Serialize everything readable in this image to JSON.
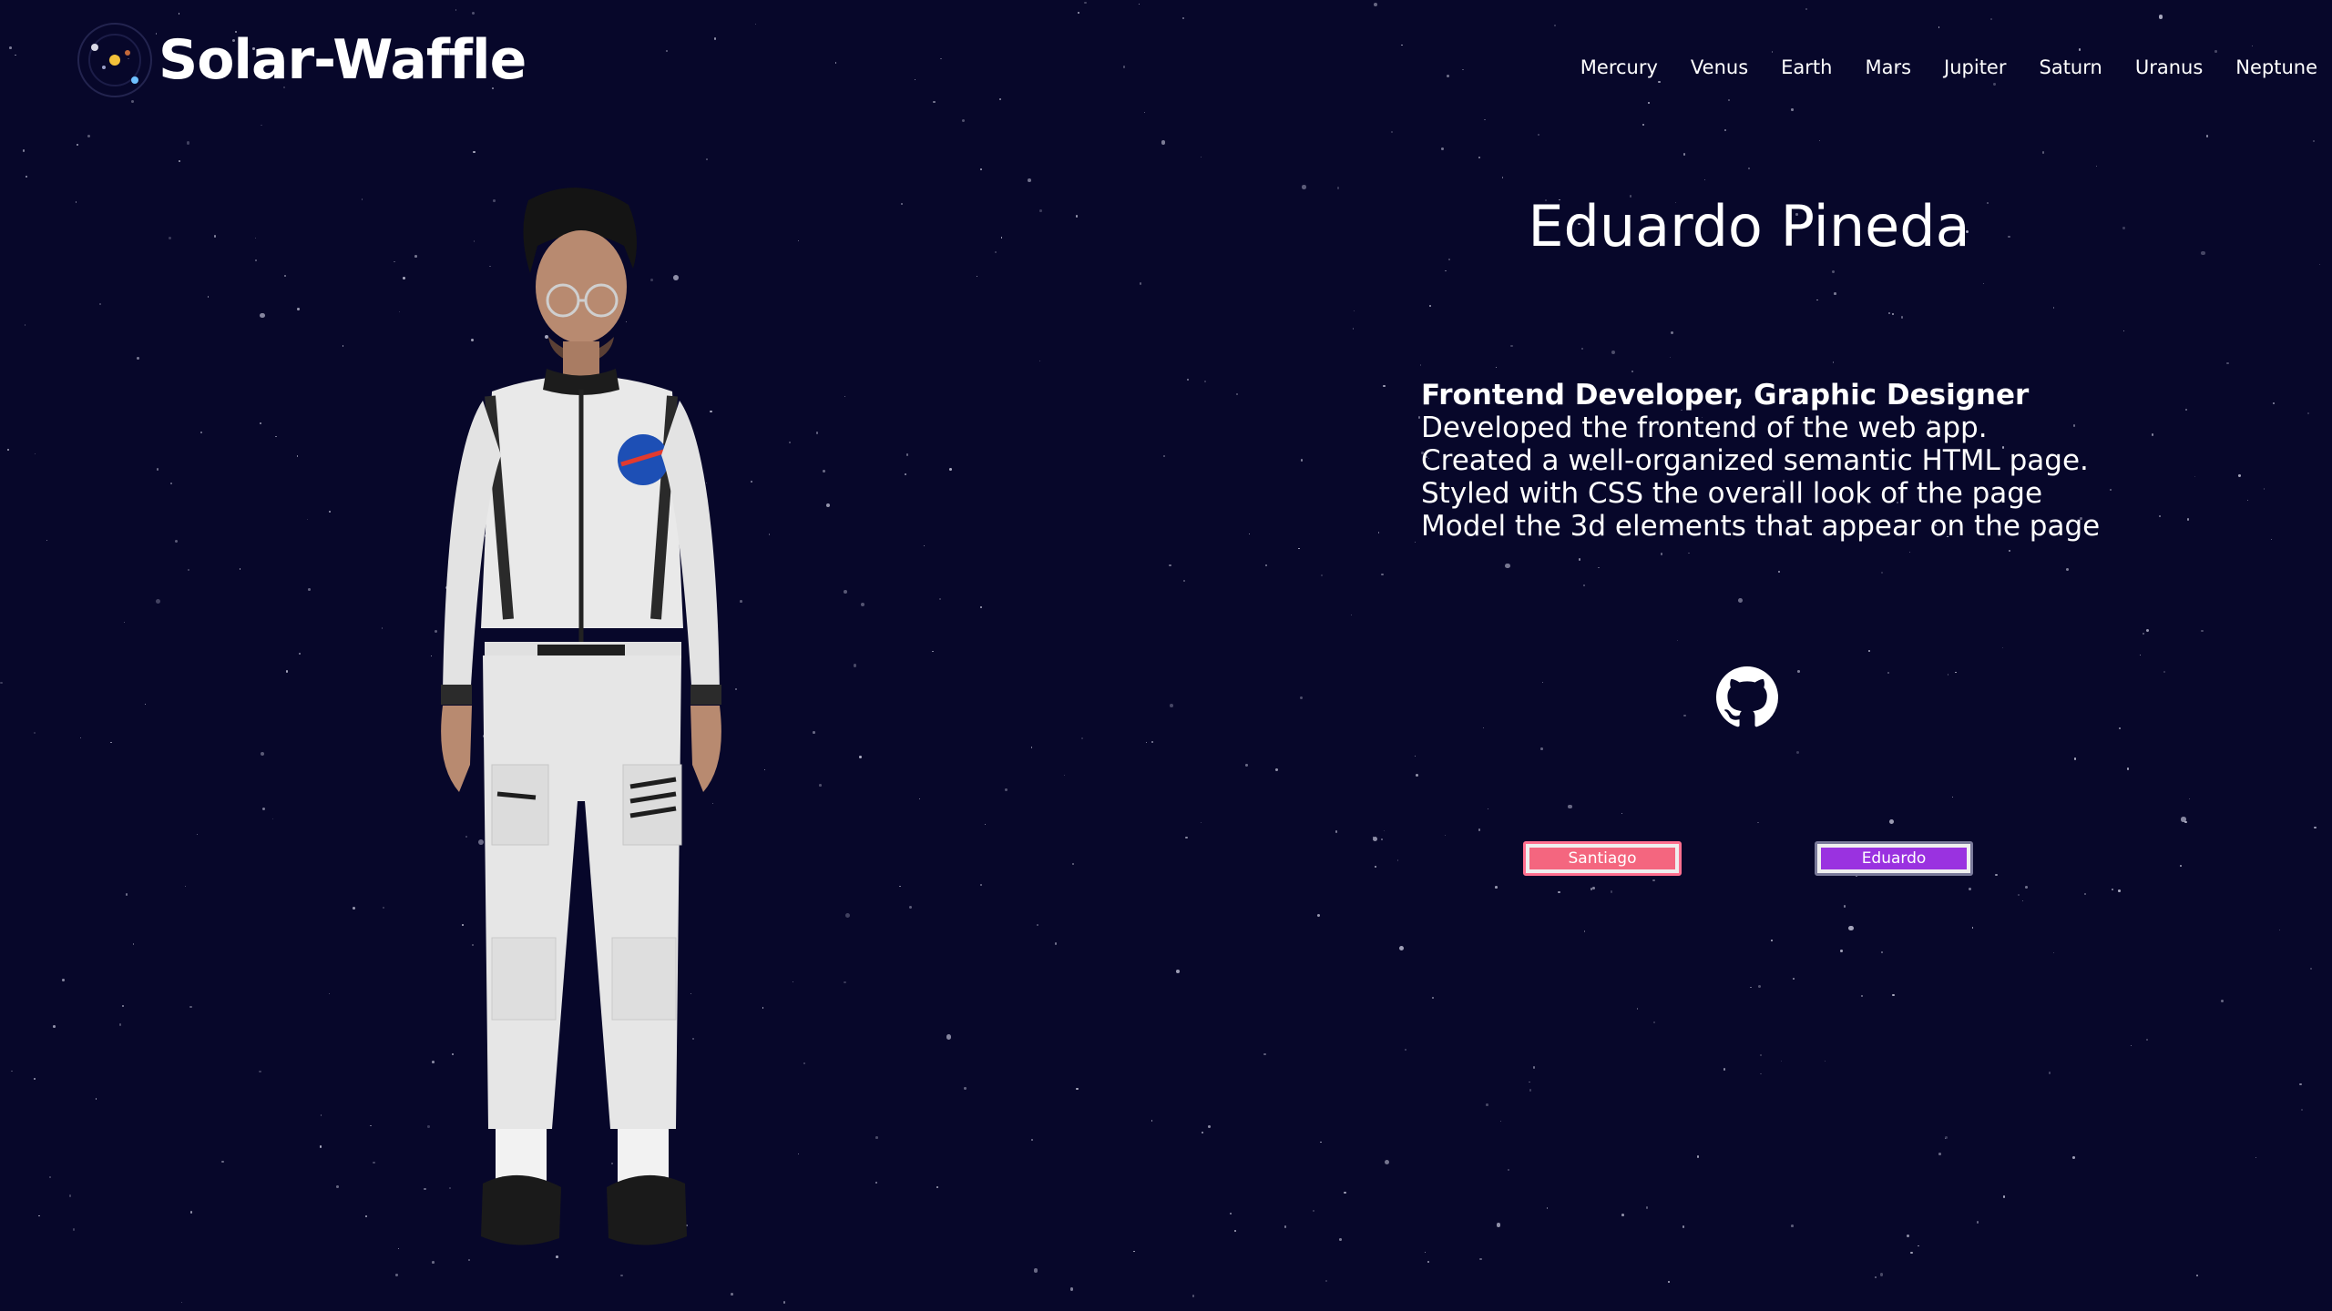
{
  "brand": {
    "name": "Solar-Waffle",
    "logo_icon": "solar-system-icon"
  },
  "nav": {
    "items": [
      "Mercury",
      "Venus",
      "Earth",
      "Mars",
      "Jupiter",
      "Saturn",
      "Uranus",
      "Neptune"
    ]
  },
  "profile": {
    "name": "Eduardo Pineda",
    "role": "Frontend Developer, Graphic Designer",
    "lines": [
      "Developed the frontend of the web app.",
      "Created a well-organized semantic HTML page.",
      "Styled with CSS the overall look of the page",
      "Model the 3d elements that appear on the page"
    ],
    "github_icon": "github-icon"
  },
  "switcher": {
    "buttons": [
      {
        "label": "Santiago",
        "color": "#f4667f"
      },
      {
        "label": "Eduardo",
        "color": "#9a32e0"
      }
    ]
  },
  "colors": {
    "background": "#07072a",
    "text": "#ffffff"
  }
}
